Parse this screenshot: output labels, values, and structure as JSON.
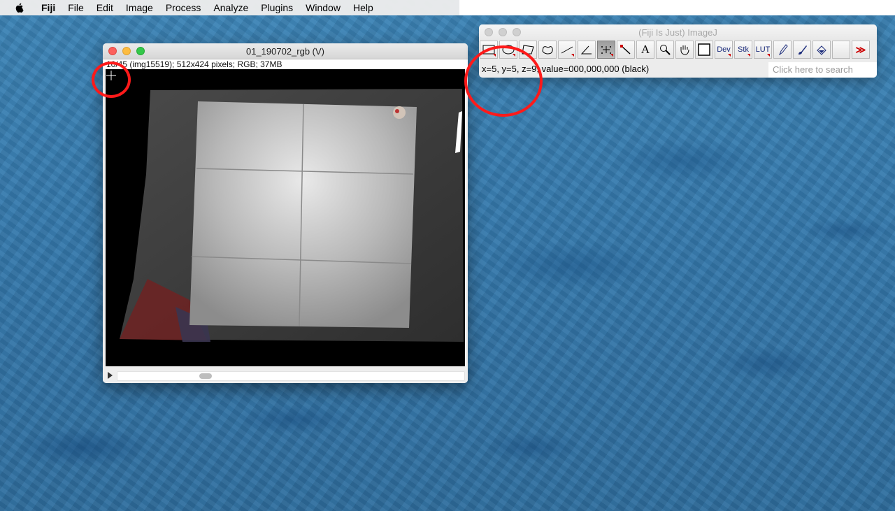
{
  "menubar": {
    "app": "Fiji",
    "items": [
      "File",
      "Edit",
      "Image",
      "Process",
      "Analyze",
      "Plugins",
      "Window",
      "Help"
    ]
  },
  "image_window": {
    "title": "01_190702_rgb (V)",
    "info": "10/45 (img15519); 512x424 pixels; RGB; 37MB"
  },
  "imagej_window": {
    "title": "(Fiji Is Just) ImageJ",
    "tools": [
      {
        "icon": "rectangle-tool-icon",
        "label": ""
      },
      {
        "icon": "oval-tool-icon",
        "label": ""
      },
      {
        "icon": "polygon-tool-icon",
        "label": ""
      },
      {
        "icon": "freehand-tool-icon",
        "label": ""
      },
      {
        "icon": "line-tool-icon",
        "label": ""
      },
      {
        "icon": "angle-tool-icon",
        "label": ""
      },
      {
        "icon": "point-tool-icon",
        "label": ""
      },
      {
        "icon": "wand-tool-icon",
        "label": ""
      },
      {
        "icon": "text-tool-icon",
        "label": "A"
      },
      {
        "icon": "magnifier-tool-icon",
        "label": ""
      },
      {
        "icon": "hand-tool-icon",
        "label": ""
      },
      {
        "icon": "color-picker-icon",
        "label": ""
      },
      {
        "icon": "dev-menu-icon",
        "label": "Dev"
      },
      {
        "icon": "stack-menu-icon",
        "label": "Stk"
      },
      {
        "icon": "lut-menu-icon",
        "label": "LUT"
      },
      {
        "icon": "pencil-tool-icon",
        "label": ""
      },
      {
        "icon": "brush-tool-icon",
        "label": ""
      },
      {
        "icon": "flood-fill-tool-icon",
        "label": ""
      },
      {
        "icon": "empty-slot-icon",
        "label": ""
      },
      {
        "icon": "more-tools-icon",
        "label": "≫"
      }
    ],
    "status": "x=5, y=5, z=9, value=000,000,000 (black)",
    "search_placeholder": "Click here to search"
  },
  "colors": {
    "annotation": "#ff1a1a",
    "selected_tool": "#9d9d9d"
  }
}
